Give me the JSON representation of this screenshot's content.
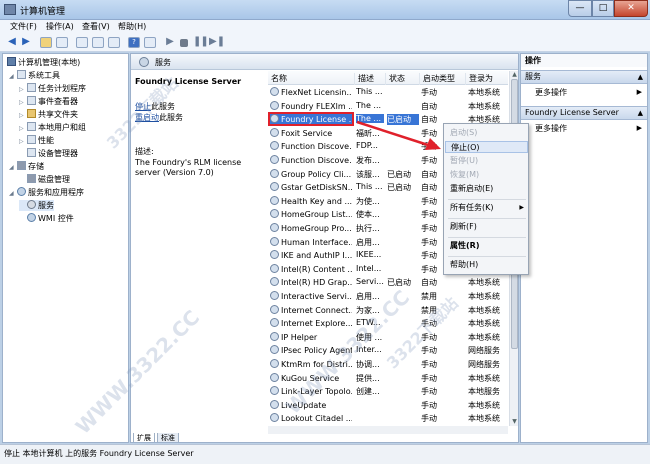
{
  "window": {
    "title": "计算机管理",
    "min_label": "—",
    "max_label": "□",
    "close_label": "✕"
  },
  "menu": [
    "文件(F)",
    "操作(A)",
    "查看(V)",
    "帮助(H)"
  ],
  "tree": {
    "root": "计算机管理(本地)",
    "items": [
      {
        "label": "系统工具",
        "level": 1,
        "icon": "tools-icon",
        "expanded": true
      },
      {
        "label": "任务计划程序",
        "level": 2,
        "icon": "clock-icon"
      },
      {
        "label": "事件查看器",
        "level": 2,
        "icon": "event-viewer-icon"
      },
      {
        "label": "共享文件夹",
        "level": 2,
        "icon": "folder-icon"
      },
      {
        "label": "本地用户和组",
        "level": 2,
        "icon": "users-icon"
      },
      {
        "label": "性能",
        "level": 2,
        "icon": "performance-icon"
      },
      {
        "label": "设备管理器",
        "level": 2,
        "icon": "device-manager-icon"
      },
      {
        "label": "存储",
        "level": 1,
        "icon": "storage-icon",
        "expanded": true
      },
      {
        "label": "磁盘管理",
        "level": 2,
        "icon": "disk-icon"
      },
      {
        "label": "服务和应用程序",
        "level": 1,
        "icon": "services-apps-icon",
        "expanded": true
      },
      {
        "label": "服务",
        "level": 2,
        "icon": "gear-icon",
        "selected": true
      },
      {
        "label": "WMI 控件",
        "level": 2,
        "icon": "wmi-icon"
      }
    ]
  },
  "services_header": "服务",
  "detail": {
    "title": "Foundry License Server",
    "stop_link": "停止",
    "stop_suffix": "此服务",
    "restart_link": "重启动",
    "restart_suffix": "此服务",
    "desc_label": "描述:",
    "desc_text": "The Foundry's RLM license server (Version 7.0)"
  },
  "columns": [
    "名称",
    "描述",
    "状态",
    "启动类型",
    "登录为"
  ],
  "rows": [
    [
      "FlexNet Licensin...",
      "This ...",
      "",
      "手动",
      "本地系统"
    ],
    [
      "Foundry FLEXlm ...",
      "The ...",
      "",
      "自动",
      "本地系统"
    ],
    [
      "Foundry License ...",
      "The ...",
      "已启动",
      "自动",
      "本地系统"
    ],
    [
      "Foxit Service",
      "福昕...",
      "",
      "手动",
      "本地系统"
    ],
    [
      "Function Discove...",
      "FDP...",
      "",
      "手动",
      "本地服务"
    ],
    [
      "Function Discove...",
      "发布...",
      "",
      "手动",
      "本地服务"
    ],
    [
      "Group Policy Cli...",
      "该服...",
      "已启动",
      "自动",
      "本地系统"
    ],
    [
      "Gstar GetDiskSN...",
      "This ...",
      "已启动",
      "自动",
      "本地系统"
    ],
    [
      "Health Key and ...",
      "为使...",
      "",
      "手动",
      "本地系统"
    ],
    [
      "HomeGroup List...",
      "使本...",
      "",
      "手动",
      "本地系统"
    ],
    [
      "HomeGroup Pro...",
      "执行...",
      "",
      "手动",
      "本地服务"
    ],
    [
      "Human Interface...",
      "启用...",
      "",
      "手动",
      "本地系统"
    ],
    [
      "IKE and AuthIP I...",
      "IKEE...",
      "",
      "手动",
      "本地系统"
    ],
    [
      "Intel(R) Content ...",
      "Intel...",
      "",
      "手动",
      "本地系统"
    ],
    [
      "Intel(R) HD Grap...",
      "Servi...",
      "已启动",
      "自动",
      "本地系统"
    ],
    [
      "Interactive Servi...",
      "启用...",
      "",
      "禁用",
      "本地系统"
    ],
    [
      "Internet Connect...",
      "为家...",
      "",
      "禁用",
      "本地系统"
    ],
    [
      "Internet Explore...",
      "ETW...",
      "",
      "手动",
      "本地系统"
    ],
    [
      "IP Helper",
      "使用 ...",
      "",
      "手动",
      "本地系统"
    ],
    [
      "IPsec Policy Agent",
      "Inter...",
      "",
      "手动",
      "网络服务"
    ],
    [
      "KtmRm for Distri...",
      "协调...",
      "",
      "手动",
      "网络服务"
    ],
    [
      "KuGou Service",
      "提供...",
      "",
      "手动",
      "本地系统"
    ],
    [
      "Link-Layer Topolo...",
      "创建...",
      "",
      "手动",
      "本地服务"
    ],
    [
      "LiveUpdate",
      "",
      "",
      "手动",
      "本地系统"
    ],
    [
      "Lookout Citadel ...",
      "",
      "",
      "手动",
      "本地系统"
    ]
  ],
  "selected_row": 2,
  "context_menu": [
    {
      "label": "启动(S)",
      "disabled": true
    },
    {
      "label": "停止(O)",
      "hover": true
    },
    {
      "label": "暂停(U)",
      "disabled": true
    },
    {
      "label": "恢复(M)",
      "disabled": true
    },
    {
      "label": "重新启动(E)"
    },
    {
      "sep": true
    },
    {
      "label": "所有任务(K)",
      "submenu": true
    },
    {
      "sep": true
    },
    {
      "label": "刷新(F)"
    },
    {
      "sep": true
    },
    {
      "label": "属性(R)",
      "bold": true
    },
    {
      "sep": true
    },
    {
      "label": "帮助(H)"
    }
  ],
  "actions": {
    "header": "操作",
    "sec1": "服务",
    "more1": "更多操作",
    "sec2": "Foundry License Server",
    "more2": "更多操作"
  },
  "tabs": [
    "扩展",
    "标准"
  ],
  "status": "停止 本地计算机 上的服务 Foundry License Server",
  "watermarks": [
    "3322下载站",
    "WWW.3322.CC"
  ]
}
